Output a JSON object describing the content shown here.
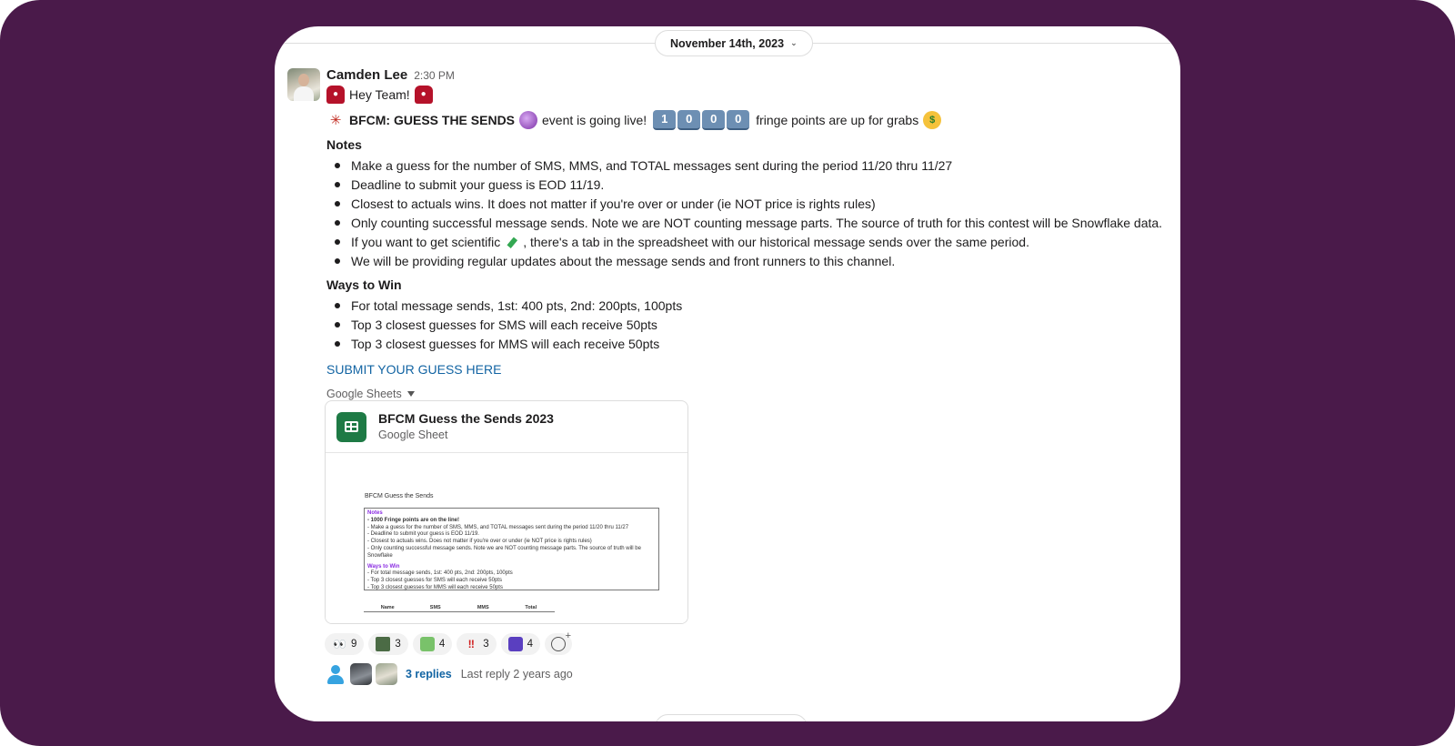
{
  "date_divider": {
    "label": "November 14th, 2023",
    "chevron_icon": "chevron-down-icon"
  },
  "message": {
    "author": "Camden Lee",
    "timestamp": "2:30 PM",
    "greeting": "Hey Team!",
    "headline": {
      "title": "BFCM: GUESS THE SENDS",
      "event_text": "event is going live!",
      "points_digits": [
        "1",
        "0",
        "0",
        "0"
      ],
      "tail_text": "fringe points are up for grabs"
    },
    "notes_title": "Notes",
    "notes": [
      "Make a guess for the number of SMS, MMS, and TOTAL messages sent during the period 11/20 thru 11/27",
      "Deadline to submit your guess is EOD 11/19.",
      "Closest to actuals wins. It does not matter if you're over or under (ie NOT price is rights rules)",
      "Only counting successful message sends. Note we are NOT counting message parts. The source of truth for this contest will be Snowflake data."
    ],
    "note_scientific": {
      "before": "If you want to get scientific",
      "after": ", there's a tab in the spreadsheet with our historical message sends over the same period."
    },
    "note_updates": "We will be providing regular updates about the message sends and front runners to this channel.",
    "ways_title": "Ways to Win",
    "ways": [
      "For total message sends, 1st: 400 pts, 2nd: 200pts, 100pts",
      "Top 3 closest guesses for SMS will each receive 50pts",
      "Top 3 closest guesses for MMS will each receive 50pts"
    ],
    "link_text": "SUBMIT YOUR GUESS HERE",
    "attachment_source": "Google Sheets"
  },
  "attachment": {
    "title": "BFCM Guess the Sends 2023",
    "subtitle": "Google Sheet",
    "preview": {
      "title": "BFCM Guess the Sends",
      "notes_header": "Notes",
      "notes_lines": [
        "- 1000 Fringe points are on the line!",
        "- Make a guess for the number of SMS, MMS, and TOTAL messages sent during the period 11/20 thru 11/27",
        "- Deadline to submit your guess is EOD 11/19.",
        "- Closest to actuals wins. Does not matter if you're over or under (ie NOT price is rights rules)",
        "- Only counting successful message sends. Note we are NOT counting message parts. The source of truth will be Snowflake"
      ],
      "ways_header": "Ways to Win",
      "ways_lines": [
        "- For total message sends, 1st: 400 pts, 2nd: 200pts, 100pts",
        "- Top 3 closest guesses for SMS will each receive 50pts",
        "- Top 3 closest guesses for MMS will each receive 50pts"
      ],
      "table_headers": [
        "Name",
        "SMS",
        "MMS",
        "Total"
      ]
    }
  },
  "reactions": [
    {
      "icon": "eyes-icon",
      "glyph": "👀",
      "count": "9"
    },
    {
      "icon": "image-emoji-icon",
      "glyph": "",
      "count": "3"
    },
    {
      "icon": "cash-emoji-icon",
      "glyph": "",
      "count": "4"
    },
    {
      "icon": "double-exclamation-icon",
      "glyph": "‼",
      "count": "3"
    },
    {
      "icon": "robot-emoji-icon",
      "glyph": "",
      "count": "4"
    }
  ],
  "thread": {
    "replies": "3 replies",
    "last_reply": "Last reply 2 years ago"
  },
  "colors": {
    "frame": "#4a1a4a",
    "link": "#1264a3",
    "sheets_green": "#1e7a45"
  }
}
